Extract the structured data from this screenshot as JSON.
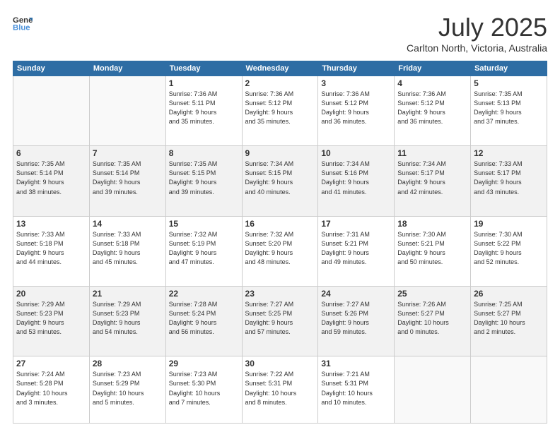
{
  "header": {
    "logo_line1": "General",
    "logo_line2": "Blue",
    "title": "July 2025",
    "subtitle": "Carlton North, Victoria, Australia"
  },
  "days_of_week": [
    "Sunday",
    "Monday",
    "Tuesday",
    "Wednesday",
    "Thursday",
    "Friday",
    "Saturday"
  ],
  "weeks": [
    [
      {
        "day": "",
        "info": ""
      },
      {
        "day": "",
        "info": ""
      },
      {
        "day": "1",
        "info": "Sunrise: 7:36 AM\nSunset: 5:11 PM\nDaylight: 9 hours\nand 35 minutes."
      },
      {
        "day": "2",
        "info": "Sunrise: 7:36 AM\nSunset: 5:12 PM\nDaylight: 9 hours\nand 35 minutes."
      },
      {
        "day": "3",
        "info": "Sunrise: 7:36 AM\nSunset: 5:12 PM\nDaylight: 9 hours\nand 36 minutes."
      },
      {
        "day": "4",
        "info": "Sunrise: 7:36 AM\nSunset: 5:12 PM\nDaylight: 9 hours\nand 36 minutes."
      },
      {
        "day": "5",
        "info": "Sunrise: 7:35 AM\nSunset: 5:13 PM\nDaylight: 9 hours\nand 37 minutes."
      }
    ],
    [
      {
        "day": "6",
        "info": "Sunrise: 7:35 AM\nSunset: 5:14 PM\nDaylight: 9 hours\nand 38 minutes."
      },
      {
        "day": "7",
        "info": "Sunrise: 7:35 AM\nSunset: 5:14 PM\nDaylight: 9 hours\nand 39 minutes."
      },
      {
        "day": "8",
        "info": "Sunrise: 7:35 AM\nSunset: 5:15 PM\nDaylight: 9 hours\nand 39 minutes."
      },
      {
        "day": "9",
        "info": "Sunrise: 7:34 AM\nSunset: 5:15 PM\nDaylight: 9 hours\nand 40 minutes."
      },
      {
        "day": "10",
        "info": "Sunrise: 7:34 AM\nSunset: 5:16 PM\nDaylight: 9 hours\nand 41 minutes."
      },
      {
        "day": "11",
        "info": "Sunrise: 7:34 AM\nSunset: 5:17 PM\nDaylight: 9 hours\nand 42 minutes."
      },
      {
        "day": "12",
        "info": "Sunrise: 7:33 AM\nSunset: 5:17 PM\nDaylight: 9 hours\nand 43 minutes."
      }
    ],
    [
      {
        "day": "13",
        "info": "Sunrise: 7:33 AM\nSunset: 5:18 PM\nDaylight: 9 hours\nand 44 minutes."
      },
      {
        "day": "14",
        "info": "Sunrise: 7:33 AM\nSunset: 5:18 PM\nDaylight: 9 hours\nand 45 minutes."
      },
      {
        "day": "15",
        "info": "Sunrise: 7:32 AM\nSunset: 5:19 PM\nDaylight: 9 hours\nand 47 minutes."
      },
      {
        "day": "16",
        "info": "Sunrise: 7:32 AM\nSunset: 5:20 PM\nDaylight: 9 hours\nand 48 minutes."
      },
      {
        "day": "17",
        "info": "Sunrise: 7:31 AM\nSunset: 5:21 PM\nDaylight: 9 hours\nand 49 minutes."
      },
      {
        "day": "18",
        "info": "Sunrise: 7:30 AM\nSunset: 5:21 PM\nDaylight: 9 hours\nand 50 minutes."
      },
      {
        "day": "19",
        "info": "Sunrise: 7:30 AM\nSunset: 5:22 PM\nDaylight: 9 hours\nand 52 minutes."
      }
    ],
    [
      {
        "day": "20",
        "info": "Sunrise: 7:29 AM\nSunset: 5:23 PM\nDaylight: 9 hours\nand 53 minutes."
      },
      {
        "day": "21",
        "info": "Sunrise: 7:29 AM\nSunset: 5:23 PM\nDaylight: 9 hours\nand 54 minutes."
      },
      {
        "day": "22",
        "info": "Sunrise: 7:28 AM\nSunset: 5:24 PM\nDaylight: 9 hours\nand 56 minutes."
      },
      {
        "day": "23",
        "info": "Sunrise: 7:27 AM\nSunset: 5:25 PM\nDaylight: 9 hours\nand 57 minutes."
      },
      {
        "day": "24",
        "info": "Sunrise: 7:27 AM\nSunset: 5:26 PM\nDaylight: 9 hours\nand 59 minutes."
      },
      {
        "day": "25",
        "info": "Sunrise: 7:26 AM\nSunset: 5:27 PM\nDaylight: 10 hours\nand 0 minutes."
      },
      {
        "day": "26",
        "info": "Sunrise: 7:25 AM\nSunset: 5:27 PM\nDaylight: 10 hours\nand 2 minutes."
      }
    ],
    [
      {
        "day": "27",
        "info": "Sunrise: 7:24 AM\nSunset: 5:28 PM\nDaylight: 10 hours\nand 3 minutes."
      },
      {
        "day": "28",
        "info": "Sunrise: 7:23 AM\nSunset: 5:29 PM\nDaylight: 10 hours\nand 5 minutes."
      },
      {
        "day": "29",
        "info": "Sunrise: 7:23 AM\nSunset: 5:30 PM\nDaylight: 10 hours\nand 7 minutes."
      },
      {
        "day": "30",
        "info": "Sunrise: 7:22 AM\nSunset: 5:31 PM\nDaylight: 10 hours\nand 8 minutes."
      },
      {
        "day": "31",
        "info": "Sunrise: 7:21 AM\nSunset: 5:31 PM\nDaylight: 10 hours\nand 10 minutes."
      },
      {
        "day": "",
        "info": ""
      },
      {
        "day": "",
        "info": ""
      }
    ]
  ]
}
